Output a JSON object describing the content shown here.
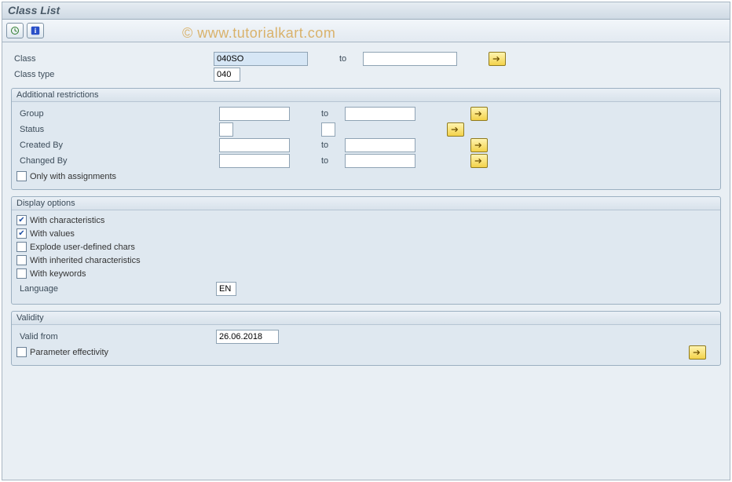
{
  "title": "Class List",
  "watermark": "© www.tutorialkart.com",
  "selection": {
    "class_label": "Class",
    "class_from": "040SO",
    "class_to": "",
    "to_label": "to",
    "class_type_label": "Class type",
    "class_type": "040"
  },
  "additional": {
    "title": "Additional restrictions",
    "to_label": "to",
    "group_label": "Group",
    "group_from": "",
    "group_to": "",
    "status_label": "Status",
    "status_from": "",
    "status_to": "",
    "created_label": "Created By",
    "created_from": "",
    "created_to": "",
    "changed_label": "Changed By",
    "changed_from": "",
    "changed_to": "",
    "only_assign_label": "Only with assignments"
  },
  "display": {
    "title": "Display options",
    "with_chars": "With characteristics",
    "with_values": "With values",
    "explode": "Explode user-defined chars",
    "inherited": "With inherited characteristics",
    "keywords": "With keywords",
    "language_label": "Language",
    "language": "EN"
  },
  "validity": {
    "title": "Validity",
    "valid_from_label": "Valid from",
    "valid_from": "26.06.2018",
    "param_eff": "Parameter effectivity"
  },
  "checks": {
    "only_assign": false,
    "with_chars": true,
    "with_values": true,
    "explode": false,
    "inherited": false,
    "keywords": false,
    "param_eff": false
  }
}
